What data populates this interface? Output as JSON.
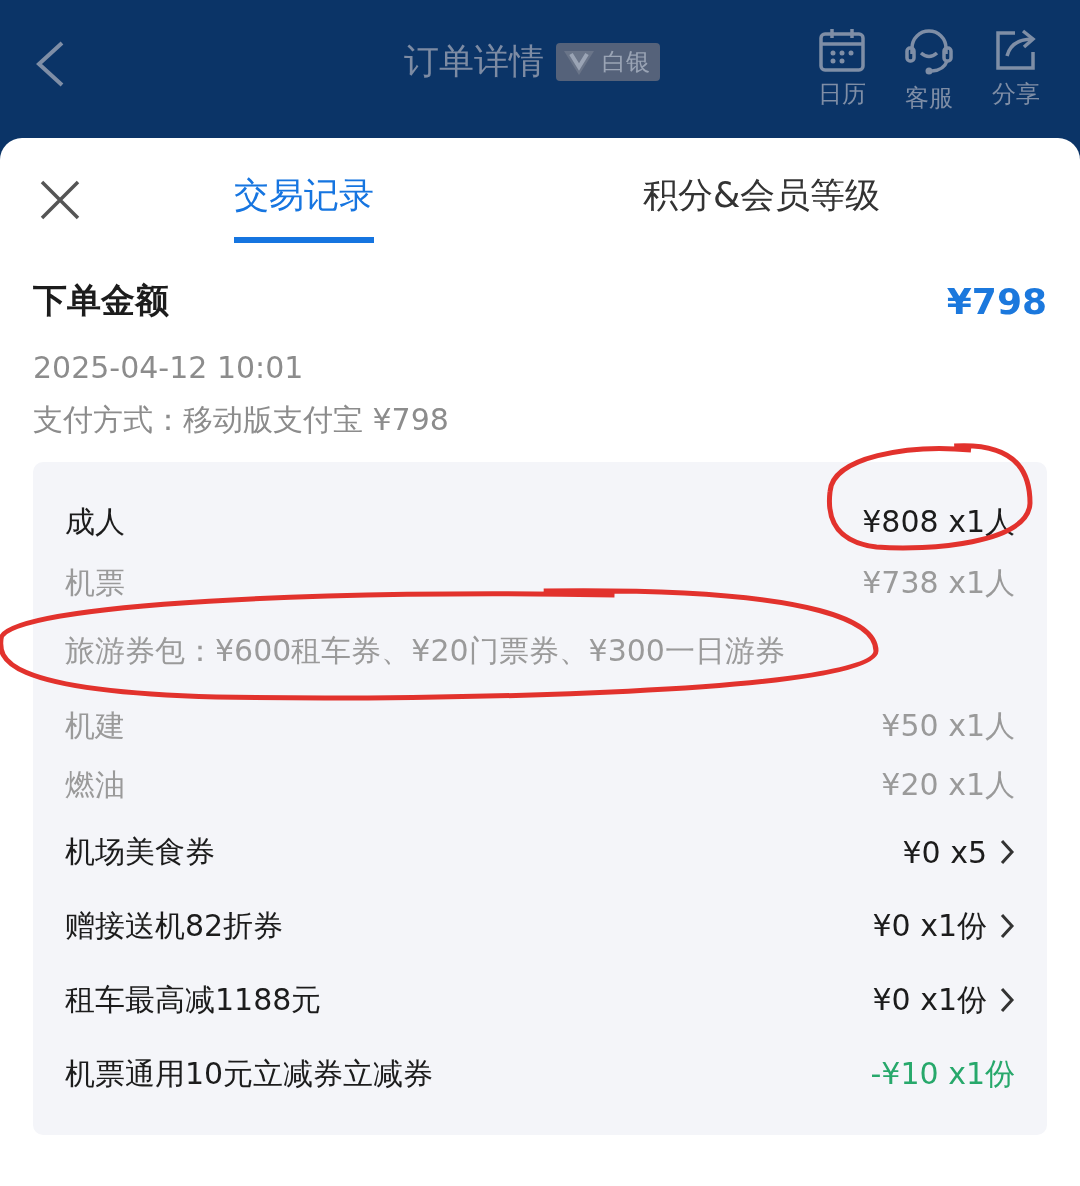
{
  "header": {
    "title": "订单详情",
    "badge": "白银",
    "actions": [
      {
        "kind": "calendar",
        "label": "日历"
      },
      {
        "kind": "service",
        "label": "客服"
      },
      {
        "kind": "share",
        "label": "分享"
      }
    ]
  },
  "tabs": [
    {
      "label": "交易记录",
      "selected": true
    },
    {
      "label": "积分&会员等级",
      "selected": false
    }
  ],
  "order": {
    "title": "下单金额",
    "amount": "¥798",
    "time": "2025-04-12 10:01",
    "payment": "支付方式：移动版支付宝 ¥798"
  },
  "rows": [
    {
      "kind": "main",
      "label": "成人",
      "value": "¥808 x1人",
      "value_circled": true
    },
    {
      "kind": "sub",
      "label": "机票",
      "value": "¥738 x1人"
    },
    {
      "kind": "note",
      "label": "旅游券包：¥600租车券、¥20门票券、¥300一日游券",
      "label_circled": true
    },
    {
      "kind": "sub",
      "label": "机建",
      "value": "¥50 x1人"
    },
    {
      "kind": "sub",
      "label": "燃油",
      "value": "¥20 x1人"
    },
    {
      "kind": "link",
      "label": "机场美食券",
      "value": "¥0 x5"
    },
    {
      "kind": "link",
      "label": "赠接送机82折券",
      "value": "¥0 x1份"
    },
    {
      "kind": "link",
      "label": "租车最高减1188元",
      "value": "¥0 x1份"
    },
    {
      "kind": "discount",
      "label": "机票通用10元立减券立减券",
      "value": "-¥10 x1份"
    }
  ]
}
